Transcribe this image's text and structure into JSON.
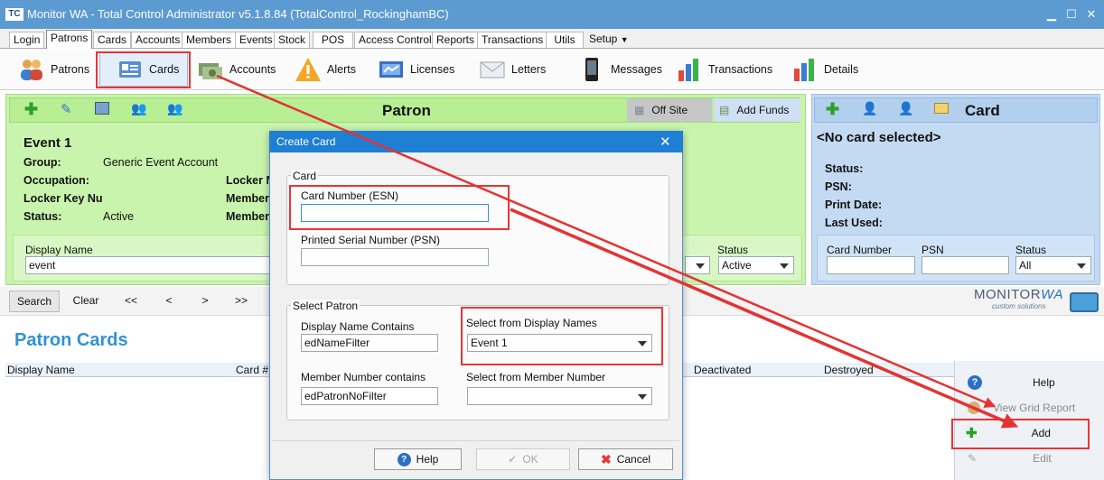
{
  "window": {
    "title": "Monitor WA - Total Control Administrator v5.1.8.84 (TotalControl_RockinghamBC)",
    "logo": "TC"
  },
  "menu_tabs": [
    "Login",
    "Patrons",
    "Cards",
    "Accounts",
    "Members",
    "Events",
    "Stock",
    "POS",
    "Access Control",
    "Reports",
    "Transactions",
    "Utils",
    "Setup"
  ],
  "ribbon": [
    "Patrons",
    "Cards",
    "Accounts",
    "Alerts",
    "Licenses",
    "Letters",
    "Messages",
    "Transactions",
    "Details"
  ],
  "patron": {
    "header": "Patron",
    "offsite": "Off Site",
    "addfunds": "Add Funds",
    "name": "Event 1",
    "group_label": "Group:",
    "group_value": "Generic Event Account",
    "occupation_label": "Occupation:",
    "locker_label": "Locker Key Nu",
    "status_label": "Status:",
    "status_value": "Active",
    "locker_no_label": "Locker N",
    "member1_label": "Member",
    "member2_label": "Member",
    "display_name_label": "Display Name",
    "display_name_value": "event",
    "status_filter_label": "Status",
    "status_filter_value": "Active"
  },
  "card": {
    "header": "Card",
    "none": "<No card selected>",
    "status_label": "Status:",
    "psn_label": "PSN:",
    "print_label": "Print Date:",
    "lastused_label": "Last Used:",
    "cn_label": "Card Number",
    "psn_col_label": "PSN",
    "st_label": "Status",
    "st_value": "All"
  },
  "nav": {
    "search": "Search",
    "clear": "Clear",
    "first": "<<",
    "prev": "<",
    "next": ">",
    "last": ">>"
  },
  "brand": {
    "main": "MONITOR",
    "wa": "WA",
    "sub": "custom solutions"
  },
  "patron_cards_title": "Patron Cards",
  "grid_cols": [
    "Display Name",
    "Card #",
    "Deactivated",
    "Destroyed"
  ],
  "actions": {
    "help": "Help",
    "report": "View Grid Report",
    "add": "Add",
    "edit": "Edit"
  },
  "dialog": {
    "title": "Create Card",
    "close": "✕",
    "card_group": "Card",
    "esn_label": "Card Number (ESN)",
    "esn_value": "",
    "psn_label": "Printed Serial Number (PSN)",
    "psn_value": "",
    "select_group": "Select Patron",
    "dn_contains_label": "Display Name Contains",
    "dn_contains_value": "edNameFilter",
    "select_dn_label": "Select from Display Names",
    "select_dn_value": "Event 1",
    "mn_contains_label": "Member Number contains",
    "mn_contains_value": "edPatronNoFilter",
    "select_mn_label": "Select from Member Number",
    "select_mn_value": "",
    "help": "Help",
    "ok": "OK",
    "cancel": "Cancel"
  },
  "colors": {
    "titlebar": "#5c9ad2",
    "patron_panel": "#c9f4ad",
    "card_panel": "#c4daf2",
    "highlight": "#e33333",
    "dialog_title": "#1e7fd4"
  }
}
